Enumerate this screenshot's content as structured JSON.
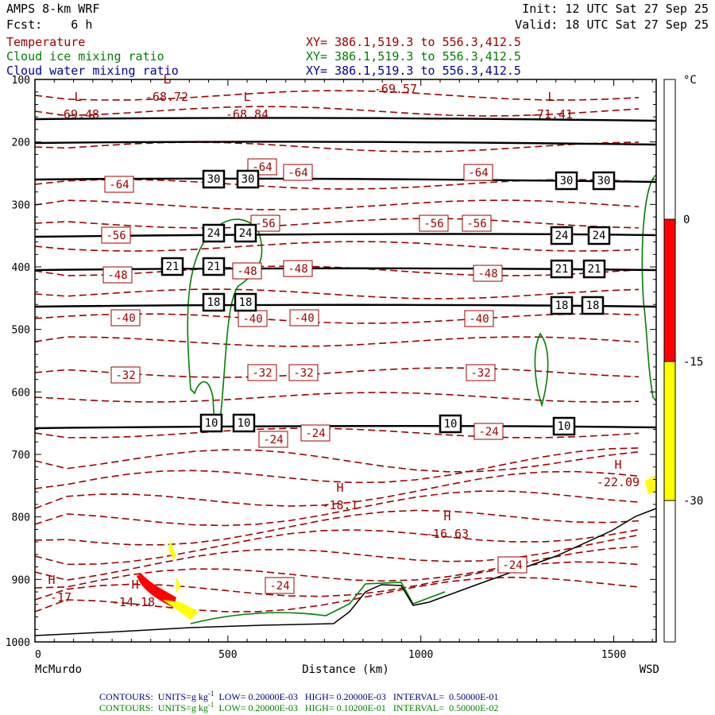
{
  "header": {
    "model": "AMPS 8-km WRF",
    "fcst": "Fcst:    6 h",
    "init": "Init: 12 UTC Sat 27 Sep 25",
    "valid": "Valid: 18 UTC Sat 27 Sep 25",
    "fields": [
      {
        "name": "Temperature",
        "xy": "XY= 386.1,519.3 to 556.3,412.5",
        "color": "#a00000"
      },
      {
        "name": "Cloud ice mixing ratio",
        "xy": "XY= 386.1,519.3 to 556.3,412.5",
        "color": "#008000"
      },
      {
        "name": "Cloud water mixing ratio",
        "xy": "XY= 386.1,519.3 to 556.3,412.5",
        "color": "#0000a0"
      }
    ]
  },
  "chart_data": {
    "type": "cross-section contour",
    "xlabel": "Distance (km)",
    "x_ticks": [
      "0",
      "500",
      "1000",
      "1500"
    ],
    "xlim": [
      0,
      1610
    ],
    "x_endpoints": [
      "McMurdo",
      "WSD"
    ],
    "y_ticks": [
      "100",
      "200",
      "300",
      "400",
      "500",
      "600",
      "700",
      "800",
      "900",
      "1000"
    ],
    "ylim": [
      1000,
      100
    ],
    "colorbar": {
      "unit": "°C",
      "ticks": [
        "0",
        "-15",
        "-30"
      ],
      "bands": [
        {
          "from": 0,
          "to": -15,
          "color": "#ff0000"
        },
        {
          "from": -15,
          "to": -30,
          "color": "#ffff00"
        }
      ]
    },
    "temperature_labels": [
      "-64",
      "-64",
      "-64",
      "-64",
      "-56",
      "-56",
      "-56",
      "-56",
      "-48",
      "-48",
      "-48",
      "-48",
      "-40",
      "-40",
      "-40",
      "-40",
      "-32",
      "-32",
      "-32",
      "-32",
      "-24",
      "-24",
      "-24",
      "-24",
      "-24"
    ],
    "black_contour_labels": [
      "30",
      "30",
      "30",
      "30",
      "24",
      "24",
      "24",
      "24",
      "21",
      "21",
      "21",
      "21",
      "18",
      "18",
      "18",
      "18",
      "10",
      "10",
      "10",
      "10"
    ],
    "extrema": [
      {
        "kind": "L",
        "value": "-69.48"
      },
      {
        "kind": "L",
        "value": "-68.72"
      },
      {
        "kind": "L",
        "value": "-68.84"
      },
      {
        "kind": "",
        "value": "-69.57"
      },
      {
        "kind": "L",
        "value": "-71.41"
      },
      {
        "kind": "H",
        "value": "-18.1"
      },
      {
        "kind": "H",
        "value": "-16.63"
      },
      {
        "kind": "H",
        "value": "-22.09"
      },
      {
        "kind": "H",
        "value": "-17"
      },
      {
        "kind": "H",
        "value": "-14.18"
      }
    ]
  },
  "footer": {
    "water": {
      "prefix": "CONTOURS:  UNITS=g kg",
      "sup": "-1",
      "rest": "  LOW= 0.20000E-03   HIGH= 0.20000E-03   INTERVAL=  0.50000E-01",
      "color": "#000080"
    },
    "ice": {
      "prefix": "CONTOURS:  UNITS=g kg",
      "sup": "-1",
      "rest": "  LOW= 0.20000E-03   HIGH= 0.10200E-01   INTERVAL=  0.50000E-02",
      "color": "#008000"
    }
  }
}
